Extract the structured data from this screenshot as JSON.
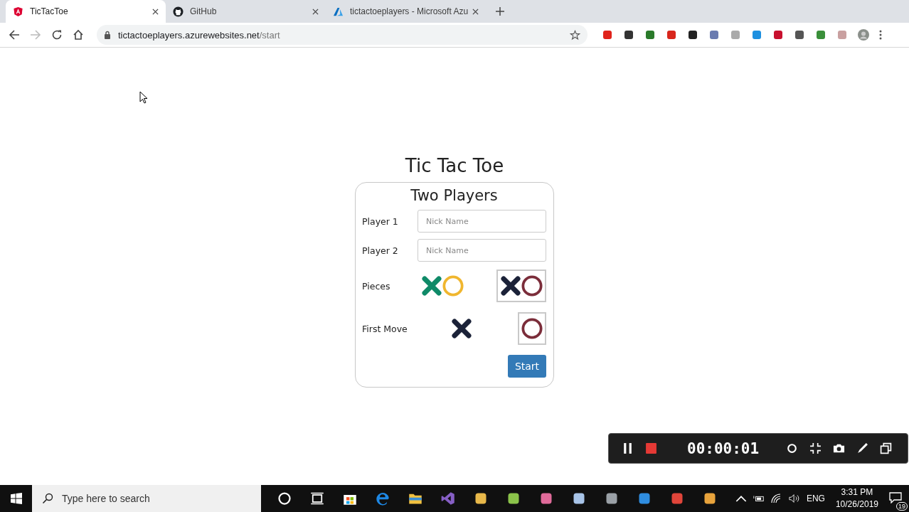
{
  "browser": {
    "tabs": [
      {
        "title": "TicTacToe",
        "selected": true
      },
      {
        "title": "GitHub",
        "selected": false
      },
      {
        "title": "tictactoeplayers - Microsoft Azu",
        "selected": false
      }
    ],
    "url": {
      "host": "tictactoeplayers.azurewebsites.net",
      "path": "/start"
    }
  },
  "page": {
    "title": "Tic Tac Toe",
    "card_title": "Two Players",
    "fields": [
      {
        "label": "Player 1",
        "placeholder": "Nick Name"
      },
      {
        "label": "Player 2",
        "placeholder": "Nick Name"
      }
    ],
    "pieces": {
      "label": "Pieces",
      "options": [
        {
          "selected": false,
          "marks": [
            {
              "kind": "x",
              "color": "#0f8a68"
            },
            {
              "kind": "o",
              "color": "#f0b62e"
            }
          ]
        },
        {
          "selected": true,
          "marks": [
            {
              "kind": "x",
              "color": "#1b2238"
            },
            {
              "kind": "o",
              "color": "#7b2d3a"
            }
          ]
        }
      ]
    },
    "first_move": {
      "label": "First Move",
      "options": [
        {
          "kind": "x",
          "selected": false
        },
        {
          "kind": "o",
          "selected": true
        }
      ]
    },
    "start_button": "Start"
  },
  "recorder": {
    "timer": "00:00:01"
  },
  "taskbar": {
    "search_placeholder": "Type here to search",
    "language": "ENG",
    "time": "3:31 PM",
    "date": "10/26/2019",
    "notification_count": "19"
  }
}
